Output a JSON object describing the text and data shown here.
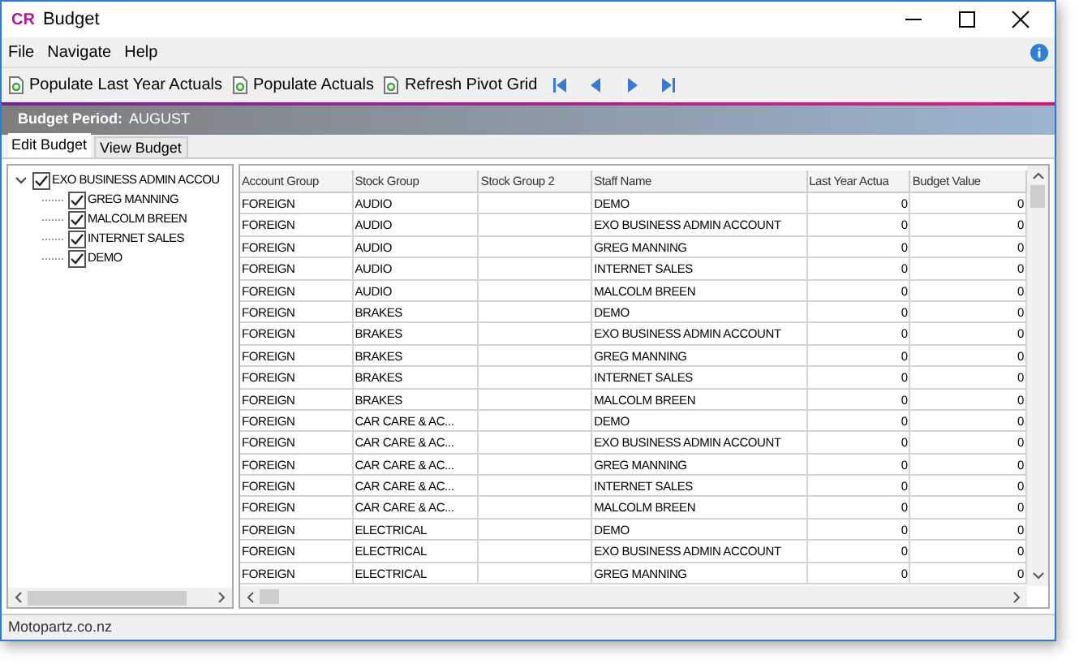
{
  "window": {
    "logo": "CR",
    "title": "Budget"
  },
  "menu": [
    "File",
    "Navigate",
    "Help"
  ],
  "toolbar": [
    {
      "kind": "action",
      "label": "Populate Last Year Actuals"
    },
    {
      "kind": "action",
      "label": "Populate Actuals"
    },
    {
      "kind": "action",
      "label": "Refresh Pivot Grid"
    },
    {
      "kind": "first"
    },
    {
      "kind": "prev"
    },
    {
      "kind": "next"
    },
    {
      "kind": "last"
    }
  ],
  "period": {
    "label": "Budget Period:",
    "value": "AUGUST"
  },
  "tabs": [
    {
      "label": "Edit Budget",
      "selected": true
    },
    {
      "label": "View Budget",
      "selected": false
    }
  ],
  "tree": [
    {
      "label": "EXO BUSINESS ADMIN ACCOU",
      "checked": true,
      "expanded": true,
      "children": [
        {
          "label": "GREG MANNING",
          "checked": true
        },
        {
          "label": "MALCOLM BREEN",
          "checked": true
        },
        {
          "label": "INTERNET SALES",
          "checked": true
        },
        {
          "label": "DEMO",
          "checked": true
        }
      ]
    }
  ],
  "table": {
    "columns": [
      "Account Group",
      "Stock Group",
      "Stock Group 2",
      "Staff Name",
      "Last Year Actua",
      "Budget Value"
    ],
    "rows": [
      [
        "FOREIGN",
        "AUDIO",
        "",
        "DEMO",
        "0",
        "0"
      ],
      [
        "FOREIGN",
        "AUDIO",
        "",
        "EXO BUSINESS ADMIN ACCOUNT",
        "0",
        "0"
      ],
      [
        "FOREIGN",
        "AUDIO",
        "",
        "GREG MANNING",
        "0",
        "0"
      ],
      [
        "FOREIGN",
        "AUDIO",
        "",
        "INTERNET SALES",
        "0",
        "0"
      ],
      [
        "FOREIGN",
        "AUDIO",
        "",
        "MALCOLM BREEN",
        "0",
        "0"
      ],
      [
        "FOREIGN",
        "BRAKES",
        "",
        "DEMO",
        "0",
        "0"
      ],
      [
        "FOREIGN",
        "BRAKES",
        "",
        "EXO BUSINESS ADMIN ACCOUNT",
        "0",
        "0"
      ],
      [
        "FOREIGN",
        "BRAKES",
        "",
        "GREG MANNING",
        "0",
        "0"
      ],
      [
        "FOREIGN",
        "BRAKES",
        "",
        "INTERNET SALES",
        "0",
        "0"
      ],
      [
        "FOREIGN",
        "BRAKES",
        "",
        "MALCOLM BREEN",
        "0",
        "0"
      ],
      [
        "FOREIGN",
        "CAR CARE & AC...",
        "",
        "DEMO",
        "0",
        "0"
      ],
      [
        "FOREIGN",
        "CAR CARE & AC...",
        "",
        "EXO BUSINESS ADMIN ACCOUNT",
        "0",
        "0"
      ],
      [
        "FOREIGN",
        "CAR CARE & AC...",
        "",
        "GREG MANNING",
        "0",
        "0"
      ],
      [
        "FOREIGN",
        "CAR CARE & AC...",
        "",
        "INTERNET SALES",
        "0",
        "0"
      ],
      [
        "FOREIGN",
        "CAR CARE & AC...",
        "",
        "MALCOLM BREEN",
        "0",
        "0"
      ],
      [
        "FOREIGN",
        "ELECTRICAL",
        "",
        "DEMO",
        "0",
        "0"
      ],
      [
        "FOREIGN",
        "ELECTRICAL",
        "",
        "EXO BUSINESS ADMIN ACCOUNT",
        "0",
        "0"
      ],
      [
        "FOREIGN",
        "ELECTRICAL",
        "",
        "GREG MANNING",
        "0",
        "0"
      ]
    ]
  },
  "status_bar": "Motopartz.co.nz"
}
